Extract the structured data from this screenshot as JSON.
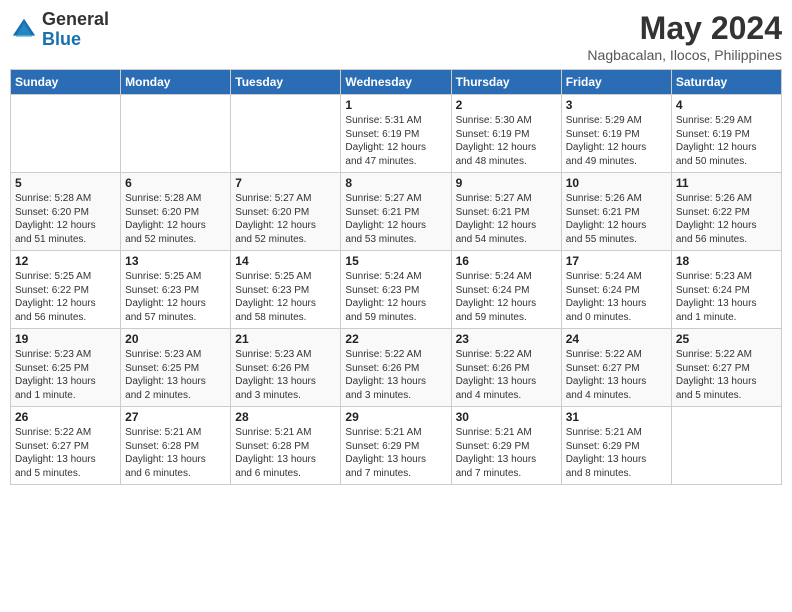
{
  "header": {
    "logo_general": "General",
    "logo_blue": "Blue",
    "month_title": "May 2024",
    "location": "Nagbacalan, Ilocos, Philippines"
  },
  "weekdays": [
    "Sunday",
    "Monday",
    "Tuesday",
    "Wednesday",
    "Thursday",
    "Friday",
    "Saturday"
  ],
  "weeks": [
    [
      {
        "day": "",
        "info": ""
      },
      {
        "day": "",
        "info": ""
      },
      {
        "day": "",
        "info": ""
      },
      {
        "day": "1",
        "info": "Sunrise: 5:31 AM\nSunset: 6:19 PM\nDaylight: 12 hours\nand 47 minutes."
      },
      {
        "day": "2",
        "info": "Sunrise: 5:30 AM\nSunset: 6:19 PM\nDaylight: 12 hours\nand 48 minutes."
      },
      {
        "day": "3",
        "info": "Sunrise: 5:29 AM\nSunset: 6:19 PM\nDaylight: 12 hours\nand 49 minutes."
      },
      {
        "day": "4",
        "info": "Sunrise: 5:29 AM\nSunset: 6:19 PM\nDaylight: 12 hours\nand 50 minutes."
      }
    ],
    [
      {
        "day": "5",
        "info": "Sunrise: 5:28 AM\nSunset: 6:20 PM\nDaylight: 12 hours\nand 51 minutes."
      },
      {
        "day": "6",
        "info": "Sunrise: 5:28 AM\nSunset: 6:20 PM\nDaylight: 12 hours\nand 52 minutes."
      },
      {
        "day": "7",
        "info": "Sunrise: 5:27 AM\nSunset: 6:20 PM\nDaylight: 12 hours\nand 52 minutes."
      },
      {
        "day": "8",
        "info": "Sunrise: 5:27 AM\nSunset: 6:21 PM\nDaylight: 12 hours\nand 53 minutes."
      },
      {
        "day": "9",
        "info": "Sunrise: 5:27 AM\nSunset: 6:21 PM\nDaylight: 12 hours\nand 54 minutes."
      },
      {
        "day": "10",
        "info": "Sunrise: 5:26 AM\nSunset: 6:21 PM\nDaylight: 12 hours\nand 55 minutes."
      },
      {
        "day": "11",
        "info": "Sunrise: 5:26 AM\nSunset: 6:22 PM\nDaylight: 12 hours\nand 56 minutes."
      }
    ],
    [
      {
        "day": "12",
        "info": "Sunrise: 5:25 AM\nSunset: 6:22 PM\nDaylight: 12 hours\nand 56 minutes."
      },
      {
        "day": "13",
        "info": "Sunrise: 5:25 AM\nSunset: 6:23 PM\nDaylight: 12 hours\nand 57 minutes."
      },
      {
        "day": "14",
        "info": "Sunrise: 5:25 AM\nSunset: 6:23 PM\nDaylight: 12 hours\nand 58 minutes."
      },
      {
        "day": "15",
        "info": "Sunrise: 5:24 AM\nSunset: 6:23 PM\nDaylight: 12 hours\nand 59 minutes."
      },
      {
        "day": "16",
        "info": "Sunrise: 5:24 AM\nSunset: 6:24 PM\nDaylight: 12 hours\nand 59 minutes."
      },
      {
        "day": "17",
        "info": "Sunrise: 5:24 AM\nSunset: 6:24 PM\nDaylight: 13 hours\nand 0 minutes."
      },
      {
        "day": "18",
        "info": "Sunrise: 5:23 AM\nSunset: 6:24 PM\nDaylight: 13 hours\nand 1 minute."
      }
    ],
    [
      {
        "day": "19",
        "info": "Sunrise: 5:23 AM\nSunset: 6:25 PM\nDaylight: 13 hours\nand 1 minute."
      },
      {
        "day": "20",
        "info": "Sunrise: 5:23 AM\nSunset: 6:25 PM\nDaylight: 13 hours\nand 2 minutes."
      },
      {
        "day": "21",
        "info": "Sunrise: 5:23 AM\nSunset: 6:26 PM\nDaylight: 13 hours\nand 3 minutes."
      },
      {
        "day": "22",
        "info": "Sunrise: 5:22 AM\nSunset: 6:26 PM\nDaylight: 13 hours\nand 3 minutes."
      },
      {
        "day": "23",
        "info": "Sunrise: 5:22 AM\nSunset: 6:26 PM\nDaylight: 13 hours\nand 4 minutes."
      },
      {
        "day": "24",
        "info": "Sunrise: 5:22 AM\nSunset: 6:27 PM\nDaylight: 13 hours\nand 4 minutes."
      },
      {
        "day": "25",
        "info": "Sunrise: 5:22 AM\nSunset: 6:27 PM\nDaylight: 13 hours\nand 5 minutes."
      }
    ],
    [
      {
        "day": "26",
        "info": "Sunrise: 5:22 AM\nSunset: 6:27 PM\nDaylight: 13 hours\nand 5 minutes."
      },
      {
        "day": "27",
        "info": "Sunrise: 5:21 AM\nSunset: 6:28 PM\nDaylight: 13 hours\nand 6 minutes."
      },
      {
        "day": "28",
        "info": "Sunrise: 5:21 AM\nSunset: 6:28 PM\nDaylight: 13 hours\nand 6 minutes."
      },
      {
        "day": "29",
        "info": "Sunrise: 5:21 AM\nSunset: 6:29 PM\nDaylight: 13 hours\nand 7 minutes."
      },
      {
        "day": "30",
        "info": "Sunrise: 5:21 AM\nSunset: 6:29 PM\nDaylight: 13 hours\nand 7 minutes."
      },
      {
        "day": "31",
        "info": "Sunrise: 5:21 AM\nSunset: 6:29 PM\nDaylight: 13 hours\nand 8 minutes."
      },
      {
        "day": "",
        "info": ""
      }
    ]
  ]
}
